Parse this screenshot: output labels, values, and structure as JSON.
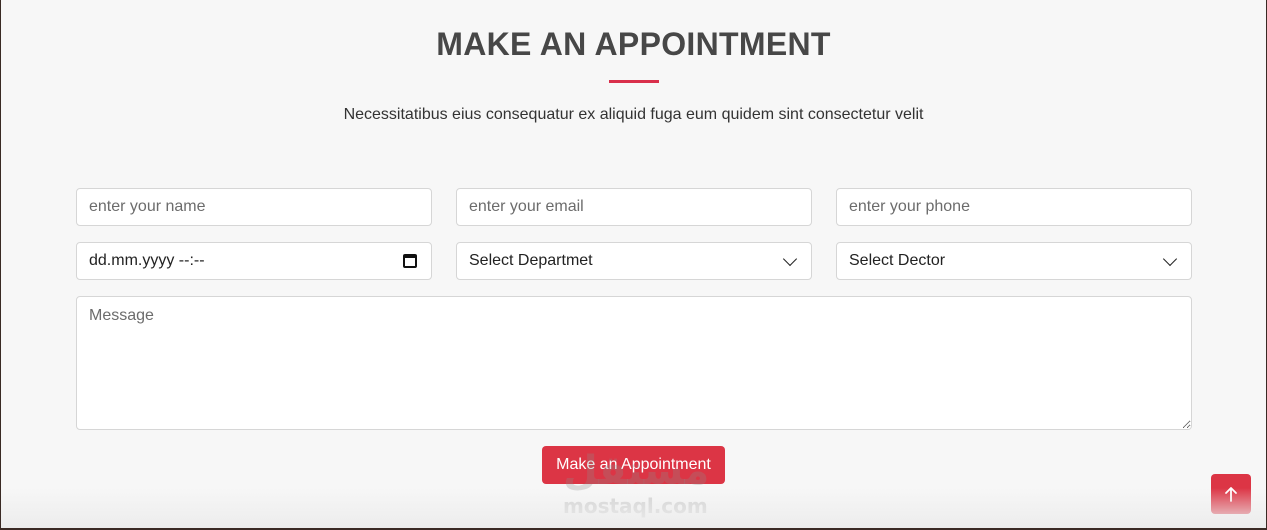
{
  "header": {
    "title": "MAKE AN APPOINTMENT",
    "subtitle": "Necessitatibus eius consequatur ex aliquid fuga eum quidem sint consectetur velit"
  },
  "form": {
    "name": {
      "placeholder": "enter your name",
      "value": ""
    },
    "email": {
      "placeholder": "enter your email",
      "value": ""
    },
    "phone": {
      "placeholder": "enter your phone",
      "value": ""
    },
    "date": {
      "value": "dd.mm.yyyy --:--"
    },
    "department": {
      "selected": "Select Departmet"
    },
    "doctor": {
      "selected": "Select Dector"
    },
    "message": {
      "placeholder": "Message",
      "value": ""
    },
    "submit_label": "Make an Appointment"
  },
  "watermark": {
    "arabic": "مستقل",
    "latin": "mostaql.com"
  },
  "icons": {
    "calendar": "calendar-icon",
    "chevron": "chevron-down-icon",
    "scroll_top": "arrow-up-icon"
  },
  "colors": {
    "accent": "#dc3545",
    "underline": "#d92f4b",
    "title": "#474747",
    "background": "#f7f7f7"
  }
}
